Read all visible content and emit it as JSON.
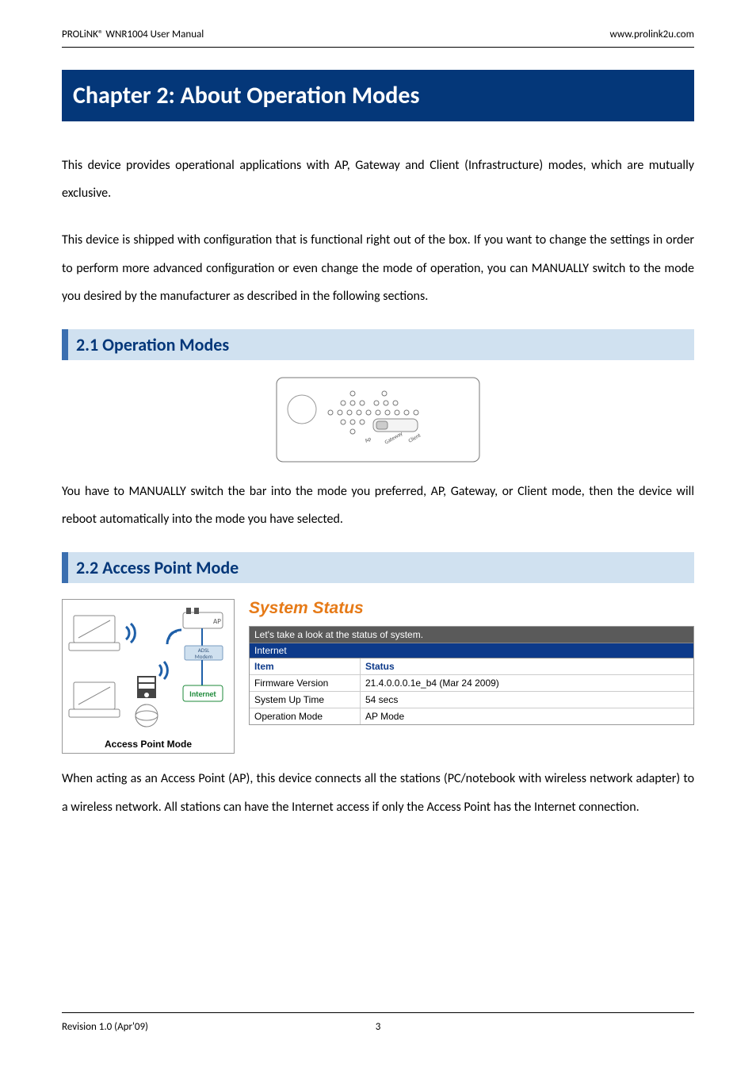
{
  "header": {
    "left": "PROLiNK® WNR1004 User Manual",
    "right": "www.prolink2u.com"
  },
  "chapter_title": "Chapter 2: About Operation Modes",
  "intro_p1": "This device provides operational applications with AP, Gateway and Client (Infrastructure) modes, which are mutually exclusive.",
  "intro_p2": "This device is shipped with configuration that is functional right out of the box. If you want to change the settings in order to perform more advanced configuration or even change the mode of operation, you can MANUALLY switch to the mode you desired by the manufacturer as described in the following sections.",
  "section_21": {
    "title": "2.1  Operation Modes",
    "device_labels": {
      "ap": "Ap",
      "gateway": "Gateway",
      "client": "Client"
    },
    "note": "You have to MANUALLY switch the bar into the mode you preferred, AP, Gateway, or Client mode, then the device will reboot automatically into the mode you have selected."
  },
  "section_22": {
    "title": "2.2  Access Point Mode",
    "diagram": {
      "ap_label": "AP",
      "modem_label": "ADSL\nModem",
      "internet_label": "Internet",
      "caption": "Access Point Mode"
    },
    "status": {
      "panel_title": "System Status",
      "caption": "Let's take a look at the status of system.",
      "group": "Internet",
      "header_item": "Item",
      "header_status": "Status",
      "rows": [
        {
          "item": "Firmware Version",
          "status": "21.4.0.0.0.1e_b4 (Mar 24 2009)"
        },
        {
          "item": "System Up Time",
          "status": "54 secs"
        },
        {
          "item": "Operation Mode",
          "status": "AP Mode"
        }
      ]
    },
    "para": "When acting as an Access Point (AP), this device connects all the stations (PC/notebook with wireless network adapter) to a wireless network. All stations can have the Internet access if only the Access Point has the Internet connection."
  },
  "footer": {
    "left": "Revision 1.0 (Apr'09)",
    "center": "3"
  }
}
